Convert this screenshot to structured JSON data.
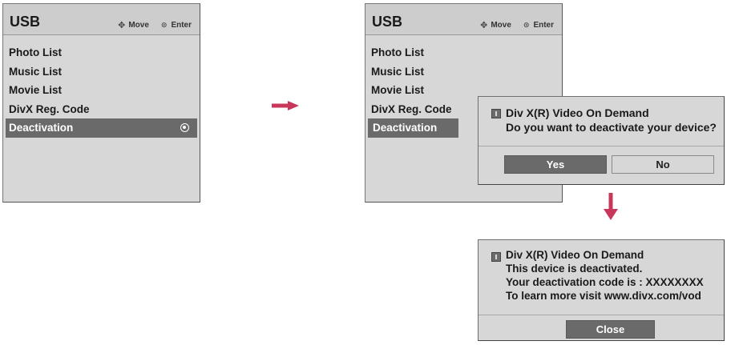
{
  "colors": {
    "arrow": "#c8375a",
    "panel_bg": "#d7d7d7",
    "selection_bg": "#6a6a6a"
  },
  "left_menu": {
    "title": "USB",
    "hint_move_icon": "move-arrows-icon",
    "hint_move": "Move",
    "hint_enter_icon": "enter-circle-icon",
    "hint_enter": "Enter",
    "items": [
      {
        "label": "Photo List"
      },
      {
        "label": "Music List"
      },
      {
        "label": "Movie List"
      },
      {
        "label": "DivX Reg. Code"
      },
      {
        "label": "Deactivation",
        "selected": true
      }
    ]
  },
  "right_menu": {
    "title": "USB",
    "hint_move": "Move",
    "hint_enter": "Enter",
    "items": [
      {
        "label": "Photo List"
      },
      {
        "label": "Music List"
      },
      {
        "label": "Movie List"
      },
      {
        "label": "DivX Reg. Code"
      },
      {
        "label": "Deactivation",
        "selected": true
      }
    ]
  },
  "confirm_dialog": {
    "icon": "info-icon",
    "title": "Div X(R) Video On Demand",
    "message": "Do you want to deactivate your device?",
    "yes_label": "Yes",
    "no_label": "No"
  },
  "result_dialog": {
    "icon": "info-icon",
    "title": "Div X(R) Video On Demand",
    "lines": [
      "This device is deactivated.",
      "Your deactivation code is : XXXXXXXX",
      "To learn more visit www.divx.com/vod"
    ],
    "close_label": "Close"
  }
}
